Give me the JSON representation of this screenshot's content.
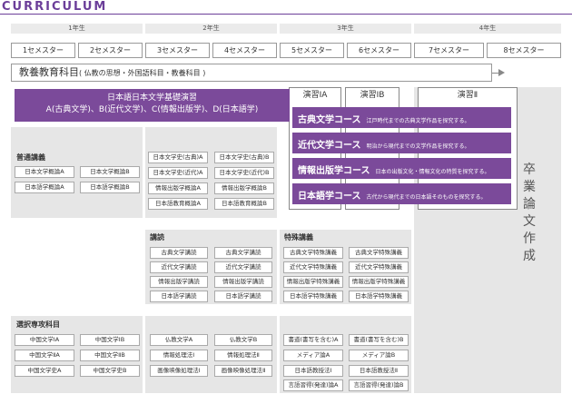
{
  "title": "CURRICULUM",
  "years": [
    "1年生",
    "2年生",
    "3年生",
    "4年生"
  ],
  "semesters": [
    "1セメスター",
    "2セメスター",
    "3セメスター",
    "4セメスター",
    "5セメスター",
    "6セメスター",
    "7セメスター",
    "8セメスター"
  ],
  "kyoyo": {
    "main": "教養教育科目",
    "sub": "( 仏教の思想・外国語科目・教養科目 )"
  },
  "enshu_main": {
    "line1": "日本語日本文学基礎演習",
    "line2": "A(古典文学)、B(近代文学)、C(情報出版学)、D(日本語学)"
  },
  "enshu_cols": [
    "演習ⅠA",
    "演習ⅠB",
    "演習Ⅱ"
  ],
  "courses": [
    {
      "name": "古典文学コース",
      "desc": "江戸時代までの古典文学作品を探究する。"
    },
    {
      "name": "近代文学コース",
      "desc": "明治から現代までの文学作品を探究する。"
    },
    {
      "name": "情報出版学コース",
      "desc": "日本の出版文化・情報文化の特質を探究する。"
    },
    {
      "name": "日本語学コース",
      "desc": "古代から現代までの日本語そのものを探究する。"
    }
  ],
  "futsu": {
    "label": "普通講義",
    "y1": [
      [
        "日本文学概論A",
        "日本文学概論B"
      ],
      [
        "日本語学概論A",
        "日本語学概論B"
      ]
    ],
    "y2": [
      [
        "日本文学史(古典)A",
        "日本文学史(古典)B"
      ],
      [
        "日本文学史(近代)A",
        "日本文学史(近代)B"
      ],
      [
        "情報出版学概論A",
        "情報出版学概論B"
      ],
      [
        "日本語教育概論A",
        "日本語教育概論B"
      ]
    ]
  },
  "kodoku": {
    "label": "講読",
    "items": [
      [
        "古典文学講読",
        "古典文学講読"
      ],
      [
        "近代文学講読",
        "近代文学講読"
      ],
      [
        "情報出版学講読",
        "情報出版学講読"
      ],
      [
        "日本語学講読",
        "日本語学講読"
      ]
    ]
  },
  "tokushu": {
    "label": "特殊講義",
    "items": [
      [
        "古典文学特殊講義",
        "古典文学特殊講義"
      ],
      [
        "近代文学特殊講義",
        "近代文学特殊講義"
      ],
      [
        "情報出版学特殊講義",
        "情報出版学特殊講義"
      ],
      [
        "日本語学特殊講義",
        "日本語学特殊講義"
      ]
    ]
  },
  "senmon": {
    "label": "選択専攻科目",
    "y1": [
      [
        "中国文学ⅠA",
        "中国文学ⅠB"
      ],
      [
        "中国文学ⅡA",
        "中国文学ⅡB"
      ],
      [
        "中国文学史A",
        "中国文学史B"
      ]
    ],
    "y2": [
      [
        "仏教文学A",
        "仏教文学B"
      ],
      [
        "情報処理法Ⅰ",
        "情報処理法Ⅱ"
      ],
      [
        "画像映像処理法Ⅰ",
        "画像映像処理法Ⅱ"
      ]
    ],
    "y3": [
      [
        "書道(書写を含む)A",
        "書道(書写を含む)B"
      ],
      [
        "メディア論A",
        "メディア論B"
      ],
      [
        "日本語教授法Ⅰ",
        "日本語教授法Ⅱ"
      ],
      [
        "言語習得(発達)論A",
        "言語習得(発達)論B"
      ]
    ]
  },
  "thesis": "卒業論文作成"
}
